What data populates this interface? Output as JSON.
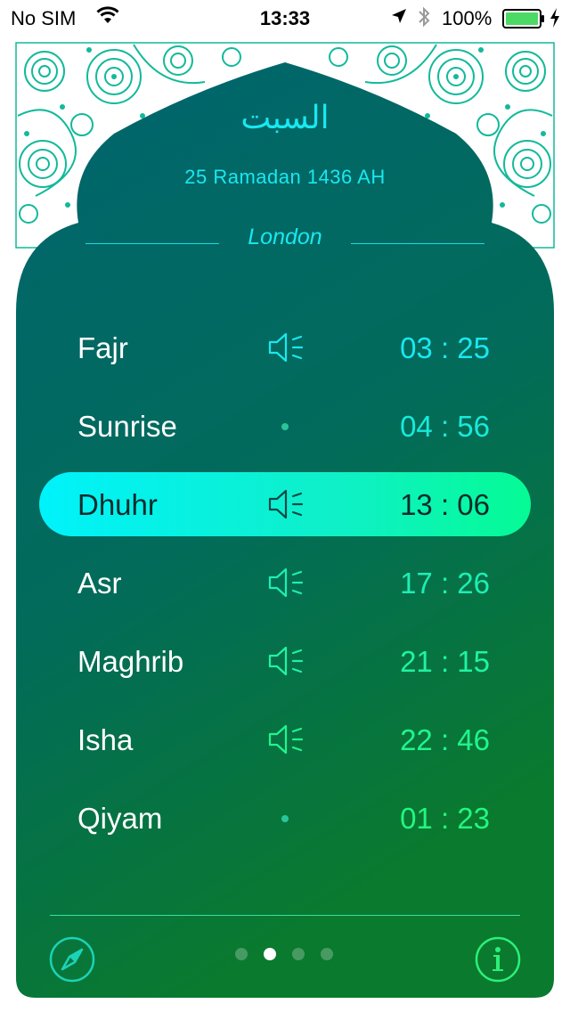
{
  "status_bar": {
    "carrier": "No SIM",
    "time": "13:33",
    "battery": "100%"
  },
  "header": {
    "day_arabic": "السبت",
    "hijri_date": "25 Ramadan 1436 AH",
    "city": "London"
  },
  "prayers": [
    {
      "name": "Fajr",
      "time": "03 : 25",
      "alert": "speaker-icon",
      "color": "#19e8f0"
    },
    {
      "name": "Sunrise",
      "time": "04 : 56",
      "alert": "dot-icon",
      "color": "#17eadc"
    },
    {
      "name": "Dhuhr",
      "time": "13 : 06",
      "alert": "speaker-icon",
      "color": "#0b2b2a",
      "active": true
    },
    {
      "name": "Asr",
      "time": "17 : 26",
      "alert": "speaker-icon",
      "color": "#1bf0b4"
    },
    {
      "name": "Maghrib",
      "time": "21 : 15",
      "alert": "speaker-icon",
      "color": "#1ff3a2"
    },
    {
      "name": "Isha",
      "time": "22 : 46",
      "alert": "speaker-icon",
      "color": "#20f58f"
    },
    {
      "name": "Qiyam",
      "time": "01 : 23",
      "alert": "dot-icon",
      "color": "#22f77f"
    }
  ],
  "pager": {
    "count": 4,
    "current": 2
  },
  "colors": {
    "card_top": "#00656f",
    "card_bottom": "#0a7a2e",
    "accent": "#19e8f0"
  }
}
